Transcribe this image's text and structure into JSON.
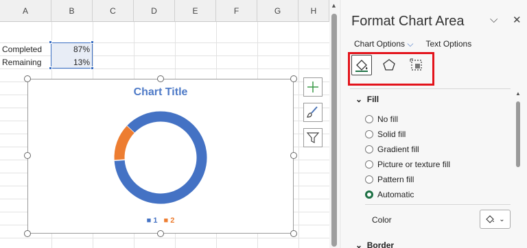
{
  "sheet": {
    "columns": [
      "A",
      "B",
      "C",
      "D",
      "E",
      "F",
      "G",
      "H"
    ],
    "rows": [
      {
        "label": "Completed",
        "value": "87%"
      },
      {
        "label": "Remaining",
        "value": "13%"
      }
    ]
  },
  "chart": {
    "title": "Chart Title",
    "legend": [
      "1",
      "2"
    ]
  },
  "chart_data": {
    "type": "pie",
    "categories": [
      "1",
      "2"
    ],
    "values": [
      87,
      13
    ],
    "colors": [
      "#4472c4",
      "#ed7d31"
    ],
    "title": "Chart Title",
    "legend": "bottom"
  },
  "pane": {
    "title": "Format Chart Area",
    "tabs": {
      "chart_options": "Chart Options",
      "text_options": "Text Options"
    },
    "fill_header": "Fill",
    "options": [
      "No fill",
      "Solid fill",
      "Gradient fill",
      "Picture or texture fill",
      "Pattern fill",
      "Automatic"
    ],
    "selected": "Automatic",
    "color_label": "Color",
    "border_header": "Border"
  }
}
